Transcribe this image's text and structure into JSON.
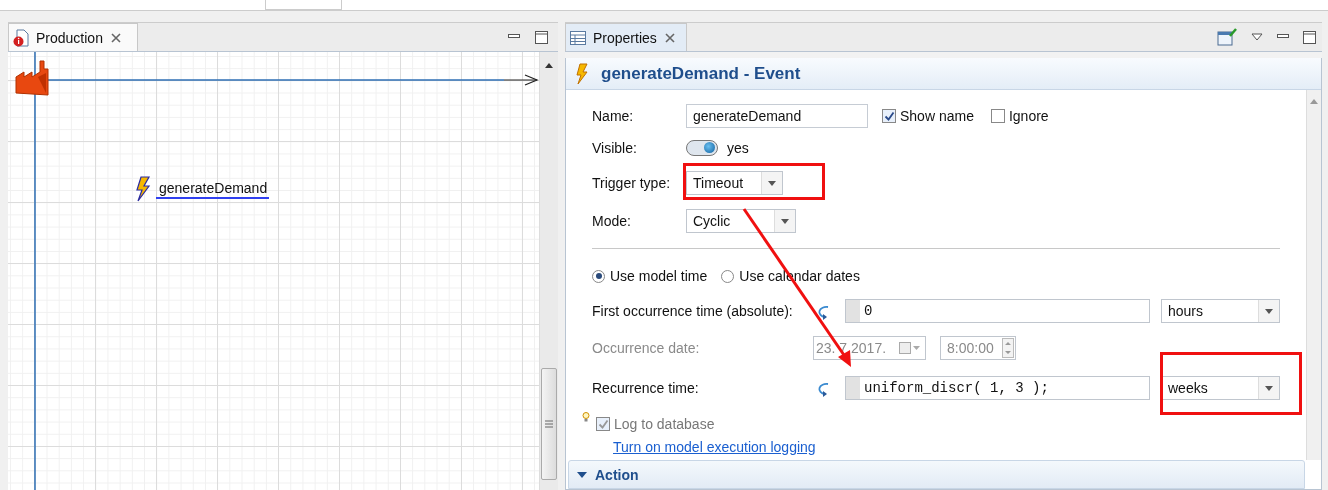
{
  "editor": {
    "tab": {
      "label": "Production",
      "selected": true
    },
    "event": {
      "name": "generateDemand"
    }
  },
  "properties": {
    "tab": {
      "label": "Properties",
      "selected": true
    },
    "title": "generateDemand - Event",
    "name": {
      "label": "Name:",
      "value": "generateDemand"
    },
    "show_name": {
      "label": "Show name",
      "checked": true
    },
    "ignore": {
      "label": "Ignore",
      "checked": false
    },
    "visible": {
      "label": "Visible:",
      "on": true,
      "text": "yes"
    },
    "trigger_type": {
      "label": "Trigger type:",
      "value": "Timeout",
      "highlighted": true
    },
    "mode": {
      "label": "Mode:",
      "value": "Cyclic"
    },
    "time_options": [
      {
        "label": "Use model time",
        "selected": true
      },
      {
        "label": "Use calendar dates",
        "selected": false
      }
    ],
    "first_occurrence": {
      "label": "First occurrence time (absolute):",
      "value": "0",
      "unit": "hours"
    },
    "occurrence_date": {
      "label": "Occurrence date:",
      "date": "23. 7.2017.",
      "time": "8:00:00",
      "disabled": true
    },
    "recurrence": {
      "label": "Recurrence time:",
      "value": "uniform_discr( 1, 3 );",
      "unit": "weeks",
      "unit_highlighted": true
    },
    "log": {
      "label": "Log to database",
      "checked": true,
      "disabled": true
    },
    "log_link": "Turn on model execution logging",
    "action_section": {
      "label": "Action",
      "expanded": true
    }
  }
}
